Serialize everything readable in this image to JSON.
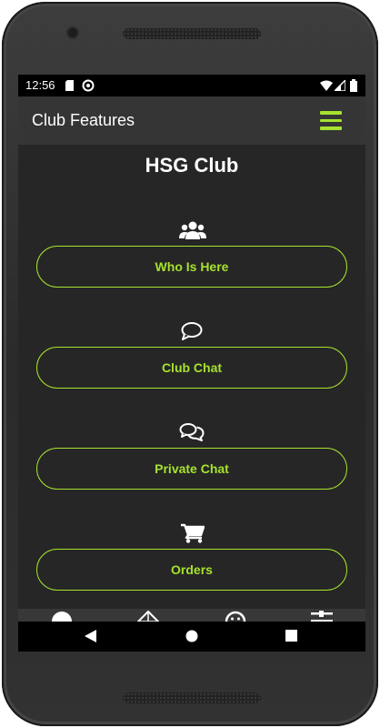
{
  "status_bar": {
    "time": "12:56"
  },
  "app_bar": {
    "title": "Club Features"
  },
  "club": {
    "name": "HSG Club"
  },
  "features": [
    {
      "label": "Who Is Here",
      "icon": "users-icon"
    },
    {
      "label": "Club Chat",
      "icon": "chat-bubble-icon"
    },
    {
      "label": "Private Chat",
      "icon": "chat-bubbles-icon"
    },
    {
      "label": "Orders",
      "icon": "cart-icon"
    }
  ],
  "colors": {
    "accent": "#a6e22e",
    "background": "#262626",
    "app_bar": "#353535"
  }
}
